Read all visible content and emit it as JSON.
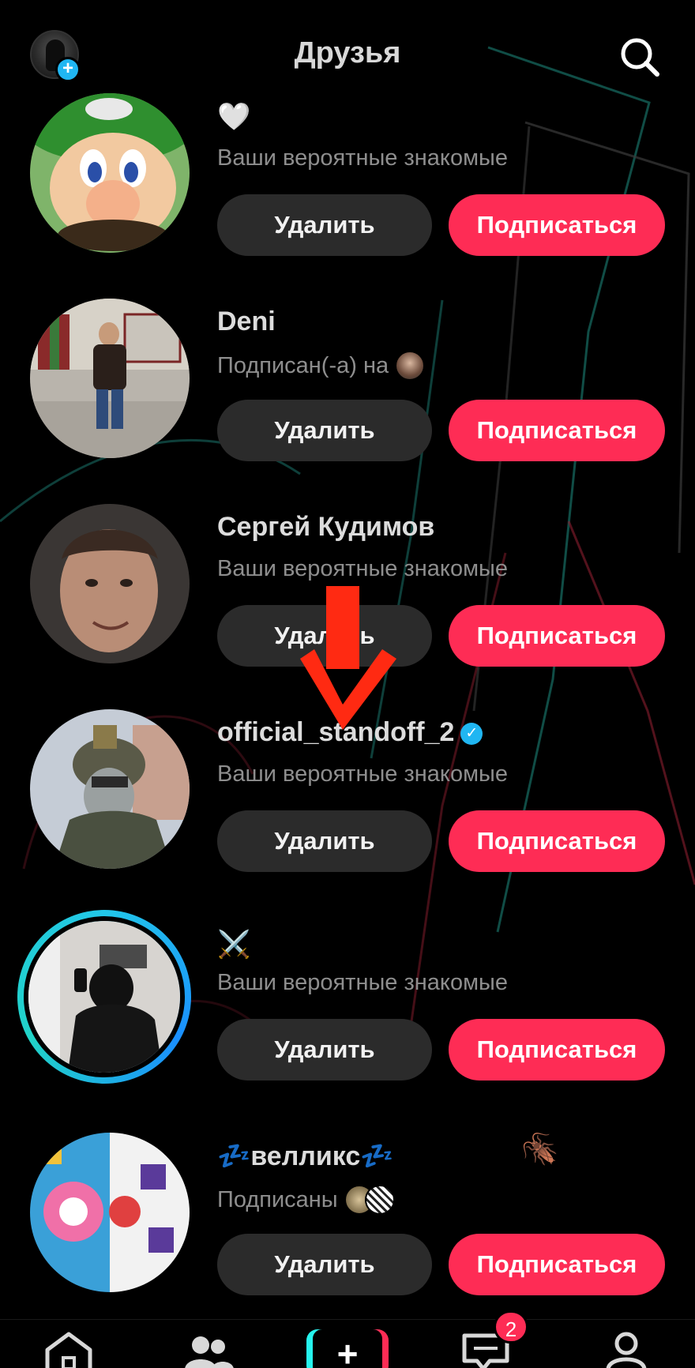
{
  "header": {
    "title": "Друзья",
    "add_icon_glyph": "+"
  },
  "suggestions": [
    {
      "name": "🤍",
      "reason": "Ваши вероятные знакомые",
      "remove_label": "Удалить",
      "follow_label": "Подписаться"
    },
    {
      "name": "Deni",
      "reason": "Подписан(-а) на",
      "remove_label": "Удалить",
      "follow_label": "Подписаться"
    },
    {
      "name": "Сергей Кудимов",
      "reason": "Ваши вероятные знакомые",
      "remove_label": "Удалить",
      "follow_label": "Подписаться"
    },
    {
      "name": "official_standoff_2",
      "verified_glyph": "✓",
      "reason": "Ваши вероятные знакомые",
      "remove_label": "Удалить",
      "follow_label": "Подписаться"
    },
    {
      "name": "⚔️",
      "reason": "Ваши вероятные знакомые",
      "remove_label": "Удалить",
      "follow_label": "Подписаться"
    },
    {
      "name": "💤велликс💤",
      "reason": "Подписаны",
      "remove_label": "Удалить",
      "follow_label": "Подписаться"
    }
  ],
  "sticker": "🪳",
  "navbar": {
    "items": [
      "home-icon",
      "friends-icon",
      "create-icon",
      "inbox-icon",
      "profile-icon"
    ],
    "create_glyph": "+",
    "inbox_badge": "2"
  },
  "colors": {
    "accent": "#fe2c55",
    "verified": "#20b6f2",
    "remove_bg": "#2b2b2b",
    "background": "#000000"
  }
}
